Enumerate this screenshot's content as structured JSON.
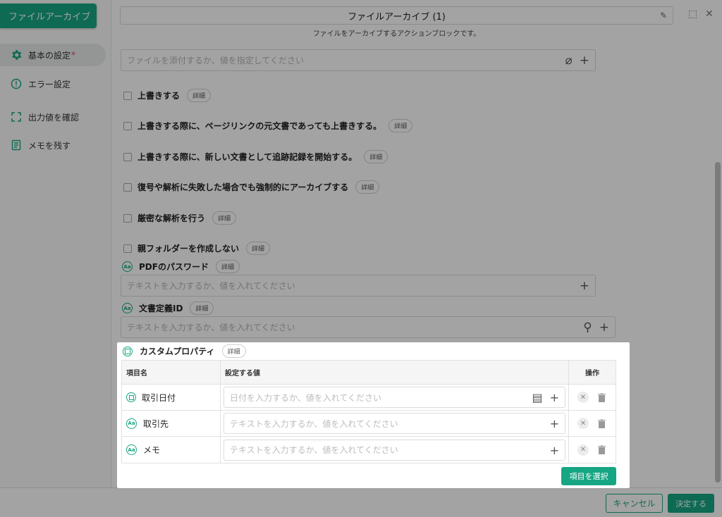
{
  "app": {
    "badge": "ファイルアーカイブ",
    "title": "ファイルアーカイブ (1)",
    "subtitle": "ファイルをアーカイブするアクションブロックです。"
  },
  "sidebar": {
    "items": [
      {
        "label": "基本の設定",
        "required_mark": "*",
        "icon": "gear-icon"
      },
      {
        "label": "エラー設定",
        "icon": "alert-circle-icon"
      },
      {
        "label": "出力値を確認",
        "icon": "frame-corners-icon"
      },
      {
        "label": "メモを残す",
        "icon": "note-icon"
      }
    ]
  },
  "form": {
    "file_placeholder": "ファイルを添付するか、値を指定してください",
    "detail_tag": "詳細",
    "checkboxes": [
      "上書きする",
      "上書きする際に、ページリンクの元文書であっても上書きする。",
      "上書きする際に、新しい文書として追跡記録を開始する。",
      "復号や解析に失敗した場合でも強制的にアーカイブする",
      "厳密な解析を行う",
      "親フォルダーを作成しない"
    ],
    "pdf_password": {
      "label": "PDFのパスワード",
      "placeholder": "テキストを入力するか、値を入れてください"
    },
    "doc_id": {
      "label": "文書定義ID",
      "placeholder": "テキストを入力するか、値を入れてください"
    }
  },
  "custom_props": {
    "title": "カスタムプロパティ",
    "tag": "詳細",
    "columns": [
      "項目名",
      "設定する値",
      "操作"
    ],
    "rows": [
      {
        "name": "取引日付",
        "placeholder": "日付を入力するか、値を入れてください",
        "type": "date"
      },
      {
        "name": "取引先",
        "placeholder": "テキストを入力するか、値を入れてください",
        "type": "text"
      },
      {
        "name": "メモ",
        "placeholder": "テキストを入力するか、値を入れてください",
        "type": "text"
      }
    ],
    "select_button": "項目を選択"
  },
  "footer": {
    "cancel": "キャンセル",
    "ok": "決定する"
  },
  "colors": {
    "accent": "#17a683",
    "required": "#e0435e"
  }
}
